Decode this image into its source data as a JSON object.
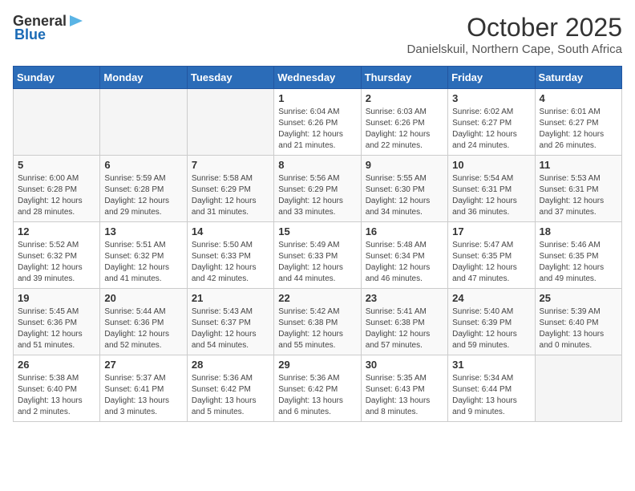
{
  "header": {
    "logo_general": "General",
    "logo_blue": "Blue",
    "month": "October 2025",
    "location": "Danielskuil, Northern Cape, South Africa"
  },
  "days_of_week": [
    "Sunday",
    "Monday",
    "Tuesday",
    "Wednesday",
    "Thursday",
    "Friday",
    "Saturday"
  ],
  "weeks": [
    [
      {
        "day": "",
        "info": ""
      },
      {
        "day": "",
        "info": ""
      },
      {
        "day": "",
        "info": ""
      },
      {
        "day": "1",
        "info": "Sunrise: 6:04 AM\nSunset: 6:26 PM\nDaylight: 12 hours\nand 21 minutes."
      },
      {
        "day": "2",
        "info": "Sunrise: 6:03 AM\nSunset: 6:26 PM\nDaylight: 12 hours\nand 22 minutes."
      },
      {
        "day": "3",
        "info": "Sunrise: 6:02 AM\nSunset: 6:27 PM\nDaylight: 12 hours\nand 24 minutes."
      },
      {
        "day": "4",
        "info": "Sunrise: 6:01 AM\nSunset: 6:27 PM\nDaylight: 12 hours\nand 26 minutes."
      }
    ],
    [
      {
        "day": "5",
        "info": "Sunrise: 6:00 AM\nSunset: 6:28 PM\nDaylight: 12 hours\nand 28 minutes."
      },
      {
        "day": "6",
        "info": "Sunrise: 5:59 AM\nSunset: 6:28 PM\nDaylight: 12 hours\nand 29 minutes."
      },
      {
        "day": "7",
        "info": "Sunrise: 5:58 AM\nSunset: 6:29 PM\nDaylight: 12 hours\nand 31 minutes."
      },
      {
        "day": "8",
        "info": "Sunrise: 5:56 AM\nSunset: 6:29 PM\nDaylight: 12 hours\nand 33 minutes."
      },
      {
        "day": "9",
        "info": "Sunrise: 5:55 AM\nSunset: 6:30 PM\nDaylight: 12 hours\nand 34 minutes."
      },
      {
        "day": "10",
        "info": "Sunrise: 5:54 AM\nSunset: 6:31 PM\nDaylight: 12 hours\nand 36 minutes."
      },
      {
        "day": "11",
        "info": "Sunrise: 5:53 AM\nSunset: 6:31 PM\nDaylight: 12 hours\nand 37 minutes."
      }
    ],
    [
      {
        "day": "12",
        "info": "Sunrise: 5:52 AM\nSunset: 6:32 PM\nDaylight: 12 hours\nand 39 minutes."
      },
      {
        "day": "13",
        "info": "Sunrise: 5:51 AM\nSunset: 6:32 PM\nDaylight: 12 hours\nand 41 minutes."
      },
      {
        "day": "14",
        "info": "Sunrise: 5:50 AM\nSunset: 6:33 PM\nDaylight: 12 hours\nand 42 minutes."
      },
      {
        "day": "15",
        "info": "Sunrise: 5:49 AM\nSunset: 6:33 PM\nDaylight: 12 hours\nand 44 minutes."
      },
      {
        "day": "16",
        "info": "Sunrise: 5:48 AM\nSunset: 6:34 PM\nDaylight: 12 hours\nand 46 minutes."
      },
      {
        "day": "17",
        "info": "Sunrise: 5:47 AM\nSunset: 6:35 PM\nDaylight: 12 hours\nand 47 minutes."
      },
      {
        "day": "18",
        "info": "Sunrise: 5:46 AM\nSunset: 6:35 PM\nDaylight: 12 hours\nand 49 minutes."
      }
    ],
    [
      {
        "day": "19",
        "info": "Sunrise: 5:45 AM\nSunset: 6:36 PM\nDaylight: 12 hours\nand 51 minutes."
      },
      {
        "day": "20",
        "info": "Sunrise: 5:44 AM\nSunset: 6:36 PM\nDaylight: 12 hours\nand 52 minutes."
      },
      {
        "day": "21",
        "info": "Sunrise: 5:43 AM\nSunset: 6:37 PM\nDaylight: 12 hours\nand 54 minutes."
      },
      {
        "day": "22",
        "info": "Sunrise: 5:42 AM\nSunset: 6:38 PM\nDaylight: 12 hours\nand 55 minutes."
      },
      {
        "day": "23",
        "info": "Sunrise: 5:41 AM\nSunset: 6:38 PM\nDaylight: 12 hours\nand 57 minutes."
      },
      {
        "day": "24",
        "info": "Sunrise: 5:40 AM\nSunset: 6:39 PM\nDaylight: 12 hours\nand 59 minutes."
      },
      {
        "day": "25",
        "info": "Sunrise: 5:39 AM\nSunset: 6:40 PM\nDaylight: 13 hours\nand 0 minutes."
      }
    ],
    [
      {
        "day": "26",
        "info": "Sunrise: 5:38 AM\nSunset: 6:40 PM\nDaylight: 13 hours\nand 2 minutes."
      },
      {
        "day": "27",
        "info": "Sunrise: 5:37 AM\nSunset: 6:41 PM\nDaylight: 13 hours\nand 3 minutes."
      },
      {
        "day": "28",
        "info": "Sunrise: 5:36 AM\nSunset: 6:42 PM\nDaylight: 13 hours\nand 5 minutes."
      },
      {
        "day": "29",
        "info": "Sunrise: 5:36 AM\nSunset: 6:42 PM\nDaylight: 13 hours\nand 6 minutes."
      },
      {
        "day": "30",
        "info": "Sunrise: 5:35 AM\nSunset: 6:43 PM\nDaylight: 13 hours\nand 8 minutes."
      },
      {
        "day": "31",
        "info": "Sunrise: 5:34 AM\nSunset: 6:44 PM\nDaylight: 13 hours\nand 9 minutes."
      },
      {
        "day": "",
        "info": ""
      }
    ]
  ]
}
